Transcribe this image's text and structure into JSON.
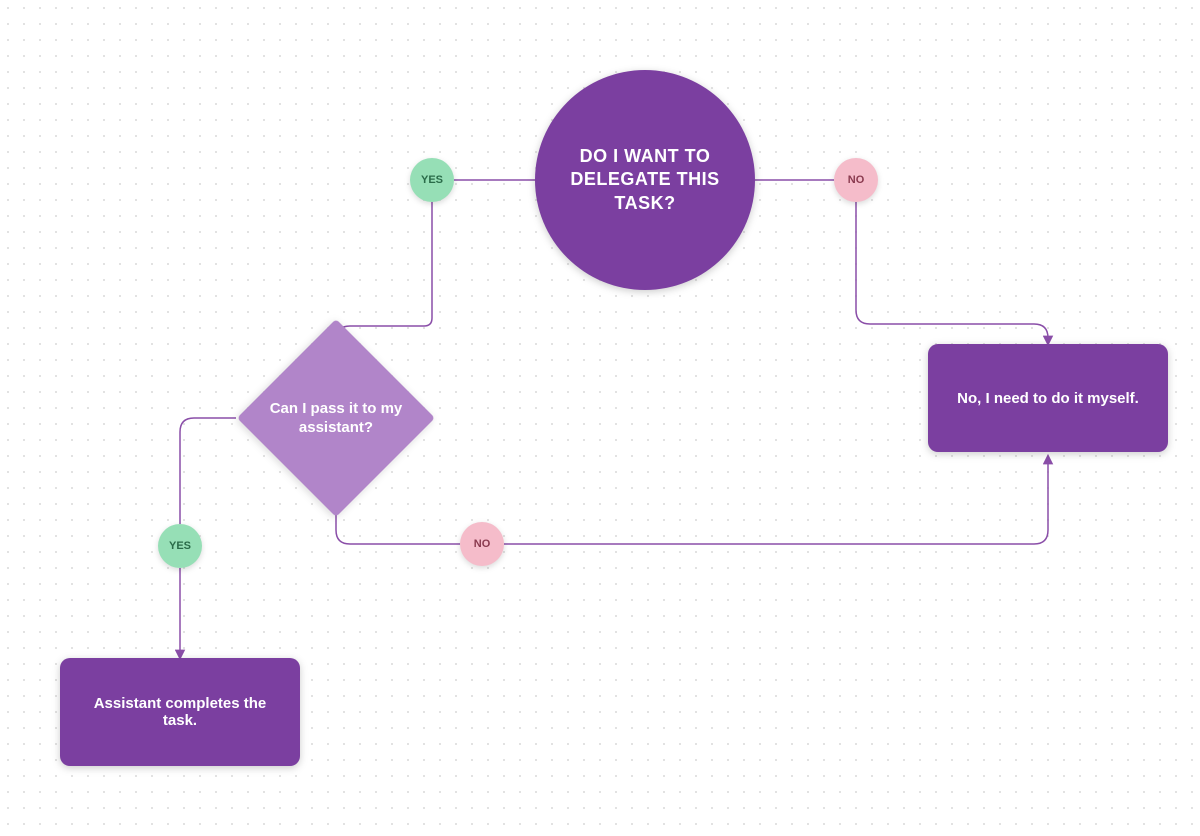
{
  "start": {
    "text": "DO I WANT TO DELEGATE THIS TASK?"
  },
  "branch": {
    "yes_label": "YES",
    "no_label": "NO"
  },
  "decision": {
    "text": "Can I pass it to my assistant?"
  },
  "decisionBranch": {
    "yes_label": "YES",
    "no_label": "NO"
  },
  "processA": {
    "text": "Assistant completes the task."
  },
  "processB": {
    "text": "No, I need to do it myself."
  },
  "colors": {
    "primary": "#7b3fa0",
    "decision": "#b185c9",
    "yes": "#96dfb6",
    "no": "#f5bcca",
    "edge": "#8a4ea8"
  }
}
